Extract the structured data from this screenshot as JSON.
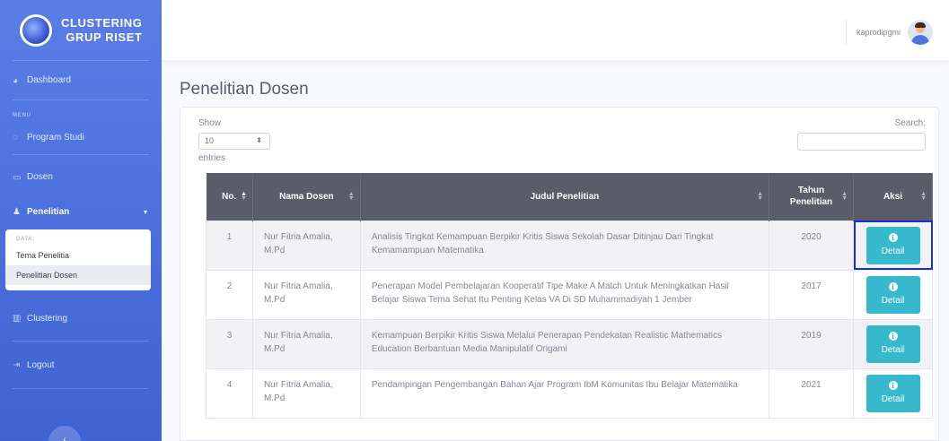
{
  "brand": {
    "line1": "CLUSTERING",
    "line2": "GRUP RISET"
  },
  "sidebar": {
    "dashboard": "Dashboard",
    "heading_menu": "MENU",
    "program_studi": "Program Studi",
    "dosen": "Dosen",
    "penelitian": "Penelitian",
    "collapse_heading": "DATA:",
    "tema_penelitian": "Tema Penelitia",
    "penelitian_dosen": "Penelitian Dosen",
    "clustering": "Clustering",
    "logout": "Logout",
    "toggle": "‹"
  },
  "topbar": {
    "username": "kaprodipgmi"
  },
  "page": {
    "title": "Penelitian Dosen"
  },
  "table_controls": {
    "show_label": "Show",
    "length_value": "10",
    "entries_label": "entries",
    "search_label": "Search:"
  },
  "table": {
    "headers": {
      "no": "No.",
      "nama": "Nama Dosen",
      "judul": "Judul Penelitian",
      "tahun": "Tahun Penelitian",
      "aksi": "Aksi"
    },
    "rows": [
      {
        "no": "1",
        "nama": "Nur Fitria Amalia, M.Pd",
        "judul": "Analisis Tingkat Kemampuan Berpikir Kritis Siswa Sekolah Dasar Ditinjau Dari Tingkat Kemamampuan Matematika",
        "tahun": "2020",
        "aksi": "Detail"
      },
      {
        "no": "2",
        "nama": "Nur Fitria Amalia, M.Pd",
        "judul": "Penerapan Model Pembelajaran Kooperatif Tipe Make A Match Untuk Meningkatkan Hasil Belajar Siswa Tema Sehat Itu Penting Kelas VA Di SD Muhammadiyah 1 Jember",
        "tahun": "2017",
        "aksi": "Detail"
      },
      {
        "no": "3",
        "nama": "Nur Fitria Amalia, M.Pd",
        "judul": "Kemampuan Berpikir Kritis Siswa Melalui Penerapan Pendekatan Realistic Mathematics Education Berbantuan Media Manipulatif Origami",
        "tahun": "2019",
        "aksi": "Detail"
      },
      {
        "no": "4",
        "nama": "Nur Fitria Amalia, M.Pd",
        "judul": "Pendampingan Pengembangan Bahan Ajar Program IbM Komunitas Ibu Belajar Matematika",
        "tahun": "2021",
        "aksi": "Detail"
      }
    ]
  },
  "colors": {
    "sidebar": "#4e73df",
    "header": "#5a5c69",
    "info": "#36b9cc",
    "focus": "#1a2fd8"
  }
}
